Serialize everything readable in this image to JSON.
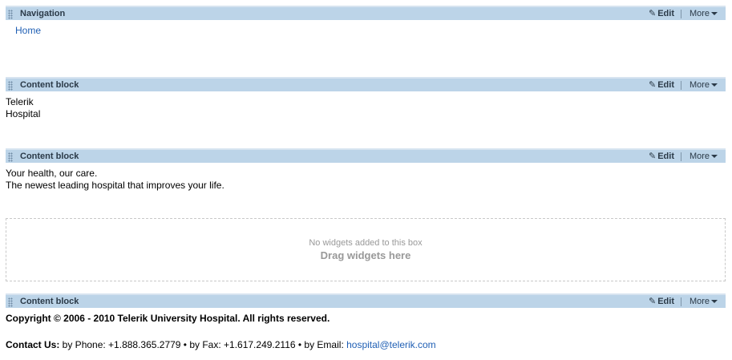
{
  "navigation_widget": {
    "title": "Navigation",
    "edit_label": "Edit",
    "more_label": "More",
    "links": [
      "Home"
    ]
  },
  "content_block_1": {
    "title": "Content block",
    "edit_label": "Edit",
    "more_label": "More",
    "lines": [
      "Telerik",
      "Hospital"
    ]
  },
  "content_block_2": {
    "title": "Content block",
    "edit_label": "Edit",
    "more_label": "More",
    "lines": [
      "Your health, our care.",
      "The newest leading hospital that improves your life."
    ]
  },
  "dropzone": {
    "hint": "No widgets added to this box",
    "drag_label": "Drag widgets here"
  },
  "content_block_3": {
    "title": "Content block",
    "edit_label": "Edit",
    "more_label": "More",
    "copyright": "Copyright © 2006 - 2010 Telerik University Hospital. All rights reserved.",
    "contact_label": "Contact Us:",
    "contact_text": " by Phone: +1.888.365.2779 • by Fax: +1.617.249.2116 • by Email: ",
    "email": "hospital@telerik.com"
  },
  "icons": {
    "grip": "grip-handle-icon",
    "edit": "pencil-icon",
    "more": "caret-down-icon"
  },
  "colors": {
    "bar_background": "#bcd4e8",
    "link": "#1f5fb4",
    "muted": "#999999"
  }
}
